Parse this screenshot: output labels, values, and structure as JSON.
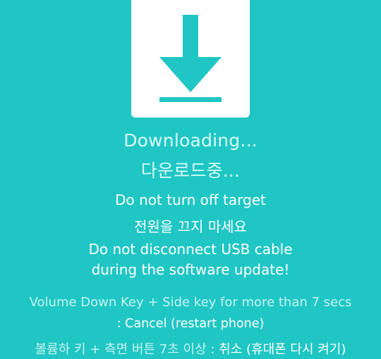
{
  "icon": {
    "name": "download-icon",
    "card_color": "#ffffff",
    "arrow_color": "#1fc6c4"
  },
  "status": {
    "title_en": "Downloading...",
    "title_ko": "다운로드중..."
  },
  "warnings": {
    "line1_en": "Do not turn off target",
    "line1_ko": "전원을 끄지 마세요",
    "line2_en_a": "Do not disconnect USB cable",
    "line2_en_b": "during the software update!"
  },
  "cancel_hint": {
    "en_line1": "Volume Down Key + Side key for more than 7 secs",
    "en_line2": ": Cancel (restart phone)",
    "ko_prefix": "볼륨하 키 + 측면 버튼 7초 이상 : ",
    "ko_action": "취소 (휴대폰 다시 켜기)"
  },
  "colors": {
    "background": "#1fc6c4",
    "title_text": "#d8fbfa",
    "hint_text": "#c6f3f2"
  }
}
